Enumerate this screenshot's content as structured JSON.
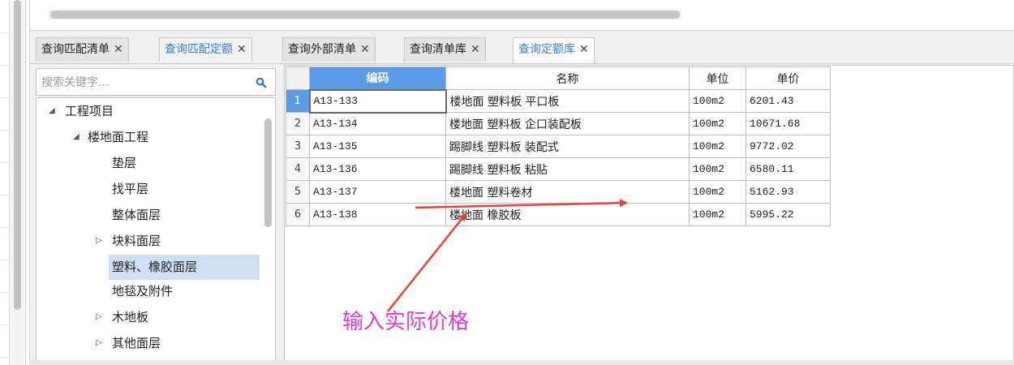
{
  "search": {
    "placeholder": "搜索关键字..."
  },
  "tabs": [
    {
      "label": "查询匹配清单",
      "close": "✕",
      "state": "normal"
    },
    {
      "label": "查询匹配定额",
      "close": "✕",
      "state": "highlight"
    },
    {
      "label": "查询外部清单",
      "close": "✕",
      "state": "normal"
    },
    {
      "label": "查询清单库",
      "close": "✕",
      "state": "normal"
    },
    {
      "label": "查询定额库",
      "close": "✕",
      "state": "active"
    }
  ],
  "tree": [
    {
      "label": "工程项目",
      "level": 0,
      "twisty": "expanded"
    },
    {
      "label": "楼地面工程",
      "level": 1,
      "twisty": "expanded"
    },
    {
      "label": "垫层",
      "level": 2,
      "twisty": "none"
    },
    {
      "label": "找平层",
      "level": 2,
      "twisty": "none"
    },
    {
      "label": "整体面层",
      "level": 2,
      "twisty": "none"
    },
    {
      "label": "块料面层",
      "level": 2,
      "twisty": "collapsed"
    },
    {
      "label": "塑料、橡胶面层",
      "level": 2,
      "twisty": "none",
      "selected": true
    },
    {
      "label": "地毯及附件",
      "level": 2,
      "twisty": "none"
    },
    {
      "label": "木地板",
      "level": 2,
      "twisty": "collapsed"
    },
    {
      "label": "其他面层",
      "level": 2,
      "twisty": "collapsed"
    }
  ],
  "grid": {
    "columns": [
      "编码",
      "名称",
      "单位",
      "单价"
    ],
    "rows": [
      {
        "num": "1",
        "code": "A13-133",
        "name": "楼地面 塑料板 平口板",
        "unit": "100m2",
        "price": "6201.43"
      },
      {
        "num": "2",
        "code": "A13-134",
        "name": "楼地面 塑料板 企口装配板",
        "unit": "100m2",
        "price": "10671.68"
      },
      {
        "num": "3",
        "code": "A13-135",
        "name": "踢脚线 塑料板 装配式",
        "unit": "100m2",
        "price": "9772.02"
      },
      {
        "num": "4",
        "code": "A13-136",
        "name": "踢脚线 塑料板 粘贴",
        "unit": "100m2",
        "price": "6580.11"
      },
      {
        "num": "5",
        "code": "A13-137",
        "name": "楼地面 塑料卷材",
        "unit": "100m2",
        "price": "5162.93"
      },
      {
        "num": "6",
        "code": "A13-138",
        "name": "楼地面 橡胶板",
        "unit": "100m2",
        "price": "5995.22"
      }
    ]
  },
  "annotation": {
    "text": "输入实际价格",
    "color": "#e13ad8",
    "arrow_color": "#e8403a"
  },
  "colors": {
    "accent": "#3a7bd5",
    "header_highlight": "#5b9be6",
    "selected_row": "#cfe0f4"
  }
}
